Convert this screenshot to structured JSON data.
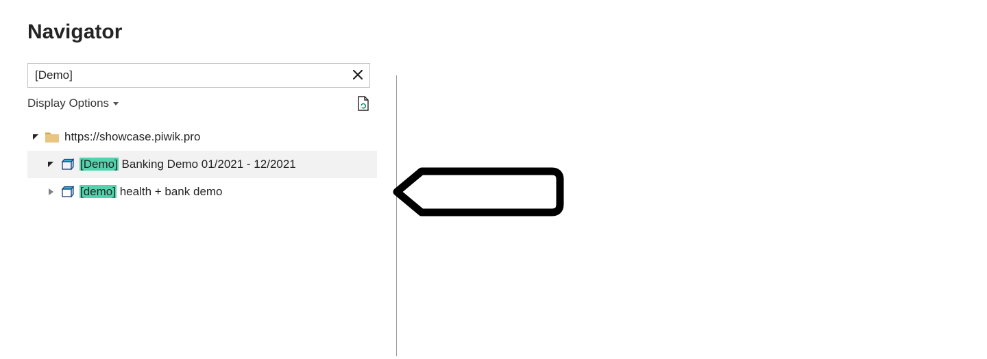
{
  "title": "Navigator",
  "search": {
    "value": "[Demo]"
  },
  "display_options_label": "Display Options",
  "tree": {
    "root": {
      "label": "https://showcase.piwik.pro",
      "children": [
        {
          "match": "[Demo]",
          "rest": " Banking Demo 01/2021 - 12/2021"
        },
        {
          "match": "[demo]",
          "rest": " health + bank demo"
        }
      ]
    }
  }
}
